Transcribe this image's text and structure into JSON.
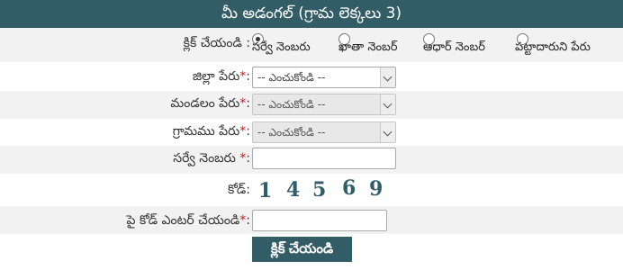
{
  "header": {
    "title": "మీ అడంగల్ (గ్రామ లెక్కలు 3)"
  },
  "form": {
    "search_by": {
      "label": "క్లిక్ చేయండి",
      "colon": ":",
      "options": [
        {
          "label": "సర్వే నెంబరు",
          "checked": true
        },
        {
          "label": "ఖాతా నెంబర్",
          "checked": false
        },
        {
          "label": "ఆధార్ నెంబర్",
          "checked": false
        },
        {
          "label": "పట్టాదారుని పేరు",
          "checked": false
        }
      ]
    },
    "district": {
      "label": "జిల్లా పేరు",
      "required_mark": "*",
      "colon": ":",
      "selected": "-- ఎంచుకోండి --"
    },
    "mandal": {
      "label": "మండలం పేరు",
      "required_mark": "*",
      "colon": ":",
      "selected": "-- ఎంచుకోండి --"
    },
    "village": {
      "label": "గ్రామము పేరు",
      "required_mark": "*",
      "colon": ":",
      "selected": "-- ఎంచుకోండి --"
    },
    "survey_number": {
      "label": "సర్వే నెంబరు",
      "required_mark": "*",
      "colon": ":",
      "value": ""
    },
    "code": {
      "label": "కోడ్",
      "colon": ":",
      "digits": [
        "1",
        "4",
        "5",
        "6",
        "9"
      ]
    },
    "code_entry": {
      "label": "పై కోడ్ ఎంటర్ చేయండి",
      "required_mark": "*",
      "colon": ":",
      "value": ""
    },
    "submit_label": "క్లిక్ చేయండి"
  },
  "colors": {
    "header_bg": "#325d66",
    "required": "#e01010",
    "button_bg": "#325d66"
  }
}
